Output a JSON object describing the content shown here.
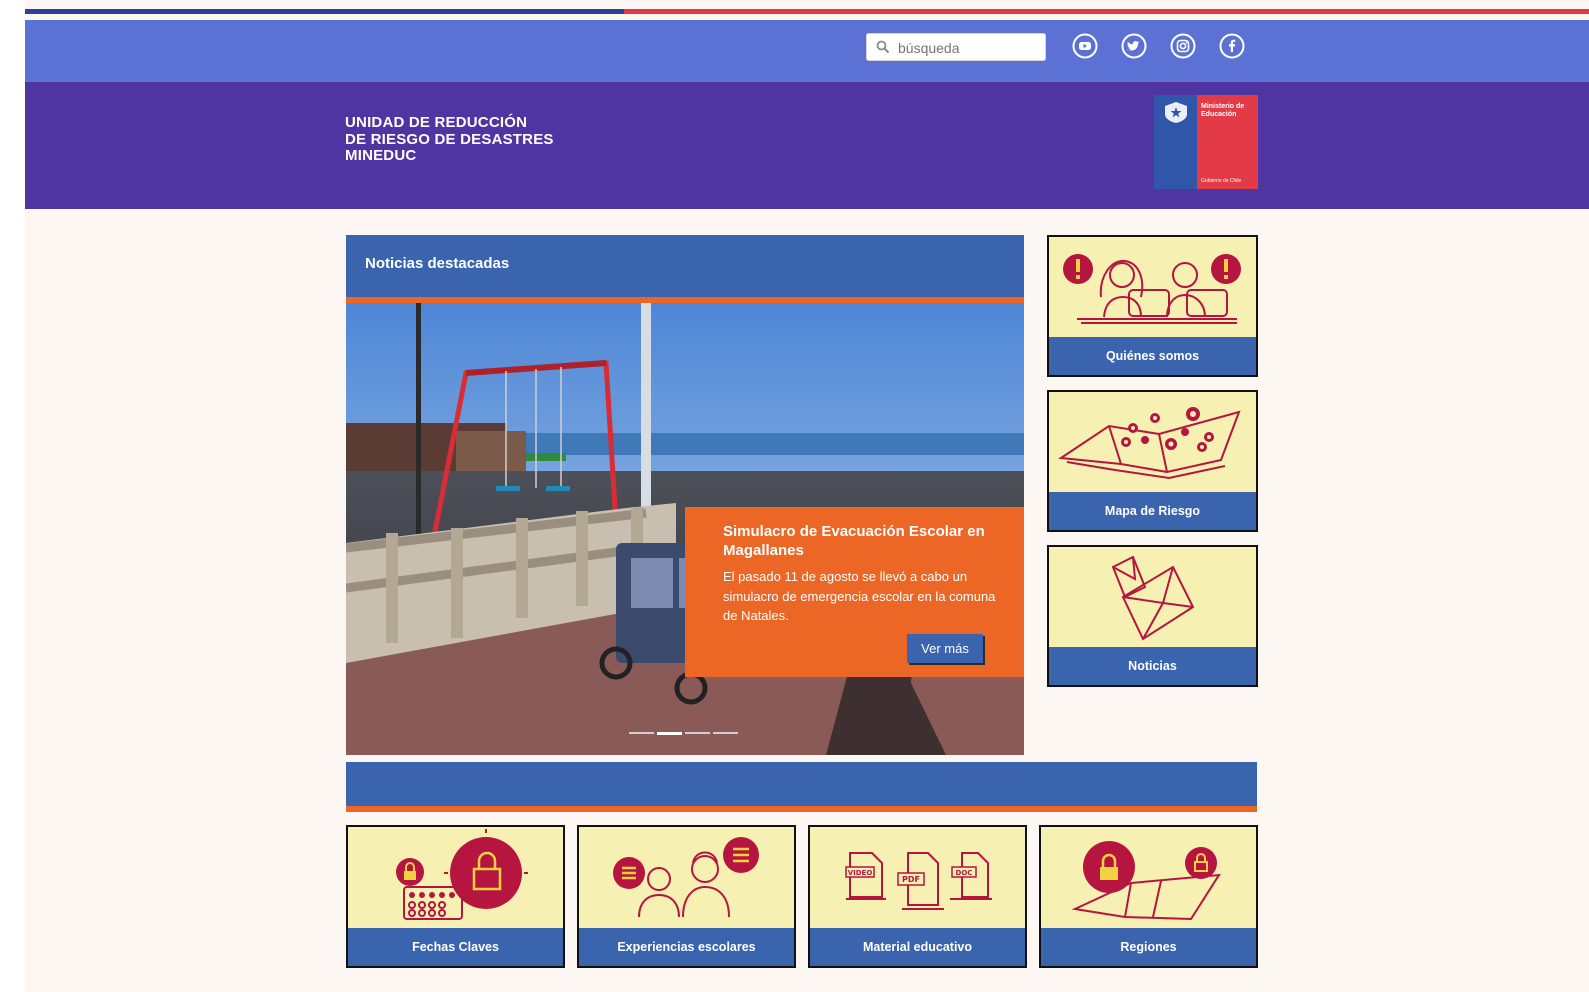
{
  "topbar": {
    "search_placeholder": "búsqueda",
    "social": [
      {
        "icon": "youtube-icon"
      },
      {
        "icon": "twitter-icon"
      },
      {
        "icon": "instagram-icon"
      },
      {
        "icon": "facebook-icon"
      }
    ]
  },
  "header": {
    "title_lines": [
      "UNIDAD DE REDUCCIÓN",
      "DE RIESGO DE DESASTRES",
      "MINEDUC"
    ],
    "logo_text_top": "Ministerio de Educación",
    "logo_text_bottom": "Gobierno de Chile"
  },
  "news": {
    "heading": "Noticias destacadas",
    "slide": {
      "title": "Simulacro de Evacuación Escolar en Magallanes",
      "text": "El pasado 11 de agosto se llevó a cabo un simulacro de emergencia escolar en la comuna de Natales.",
      "button": "Ver más"
    },
    "slide_count": 4,
    "active_slide": 2
  },
  "side_cards": [
    {
      "label": "Quiénes somos",
      "icon": "people-alert-icon"
    },
    {
      "label": "Mapa de Riesgo",
      "icon": "risk-map-icon"
    },
    {
      "label": "Noticias",
      "icon": "envelope-icon"
    }
  ],
  "bottom_cards": [
    {
      "label": "Fechas Claves",
      "icon": "calendar-lock-icon"
    },
    {
      "label": "Experiencias escolares",
      "icon": "students-chat-icon"
    },
    {
      "label": "Material educativo",
      "icon": "documents-icon"
    },
    {
      "label": "Regiones",
      "icon": "map-lock-icon"
    }
  ],
  "colors": {
    "topbar": "#5b71d3",
    "header": "#4f35a1",
    "accent_blue": "#3a64ad",
    "accent_orange": "#ec6625",
    "card_bg": "#f6f0b3",
    "illustration": "#b5153f"
  }
}
